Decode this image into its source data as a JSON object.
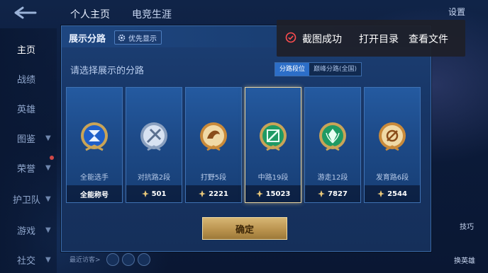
{
  "topnav": {
    "tabs": [
      "个人主页",
      "电竞生涯"
    ],
    "settings_label": "设置"
  },
  "sidebar": {
    "items": [
      {
        "label": "主页",
        "active": true
      },
      {
        "label": "战绩"
      },
      {
        "label": "英雄"
      },
      {
        "label": "图鉴"
      },
      {
        "label": "荣誉"
      },
      {
        "label": "护卫队"
      },
      {
        "label": "游戏"
      },
      {
        "label": "社交"
      }
    ]
  },
  "modal": {
    "title": "展示分路",
    "priority_label": "优先显示",
    "subtitle": "请选择展示的分路",
    "segments": {
      "active": "分路段位",
      "inactive": "巅峰分路(全国)"
    },
    "cards": [
      {
        "label": "全能选手",
        "foot": "全能称号",
        "emblem": "all-round-emblem",
        "color": "#3b82f6"
      },
      {
        "label": "对抗路2段",
        "foot": "501",
        "emblem": "clash-lane-emblem",
        "color": "#8aa4c8"
      },
      {
        "label": "打野5段",
        "foot": "2221",
        "emblem": "jungle-emblem",
        "color": "#c9823a"
      },
      {
        "label": "中路19段",
        "foot": "15023",
        "emblem": "mid-lane-emblem",
        "color": "#2fb57a",
        "selected": true
      },
      {
        "label": "游走12段",
        "foot": "7827",
        "emblem": "roam-emblem",
        "color": "#2fb57a"
      },
      {
        "label": "发育路6段",
        "foot": "2544",
        "emblem": "farm-lane-emblem",
        "color": "#c9823a"
      }
    ],
    "confirm_label": "确定"
  },
  "toast": {
    "message": "截图成功",
    "link_open_dir": "打开目录",
    "link_view_file": "查看文件"
  },
  "bottom": {
    "recent_label": "最近访客>",
    "right_buttons": [
      "技巧",
      "换英雄"
    ]
  },
  "colors": {
    "accent": "#2c6ec8",
    "gold": "#d7b674",
    "selected_border": "#e9d6a2",
    "toast_ok": "#ff4d4f"
  }
}
